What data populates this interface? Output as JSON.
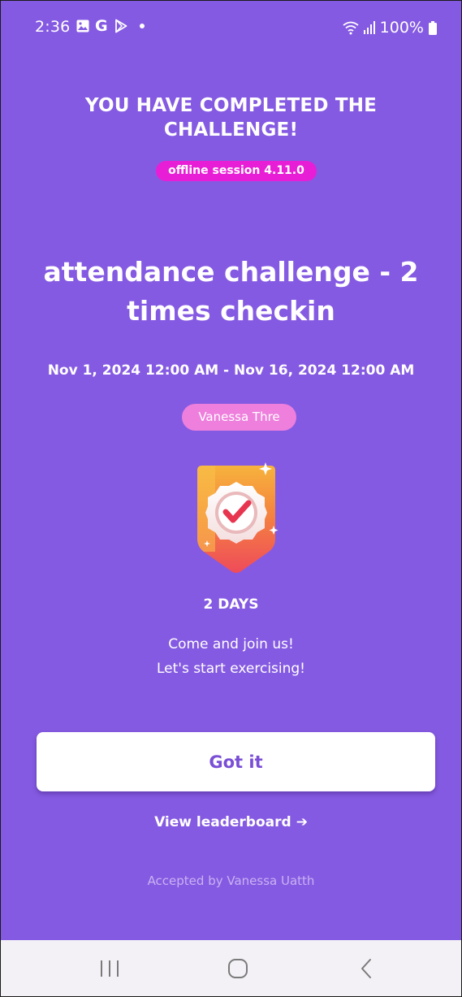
{
  "status_bar": {
    "time": "2:36",
    "battery_percent": "100%",
    "left_icons": [
      "gallery-icon",
      "google-icon",
      "play-store-icon",
      "notification-dot-icon"
    ],
    "right_icons": [
      "wifi-icon",
      "signal-icon",
      "battery-icon"
    ],
    "google_glyph": "G"
  },
  "completion": {
    "heading": "YOU HAVE COMPLETED THE CHALLENGE!",
    "version_badge": "offline session 4.11.0"
  },
  "challenge": {
    "title": "attendance challenge - 2 times checkin",
    "dates": "Nov 1, 2024 12:00 AM - Nov 16, 2024 12:00 AM",
    "user_chip": "Vanessa Thre",
    "badge_icon": "medal-check-icon",
    "days": "2 DAYS",
    "message_line1": "Come and join us!",
    "message_line2": "Let's start exercising!"
  },
  "actions": {
    "got_it_label": "Got it",
    "leaderboard_label": "View leaderboard",
    "leaderboard_arrow": "➔"
  },
  "footer": {
    "accepted_text": "Accepted by Vanessa Uatth"
  },
  "nav_bar": {
    "items": [
      "recent-apps-icon",
      "home-icon",
      "back-icon"
    ]
  },
  "colors": {
    "background": "#855ae2",
    "badge_magenta": "#e81ed6",
    "chip_pink": "#ee7fdc",
    "button_text": "#7a4fd6",
    "nav_bar": "#f3f1f6"
  }
}
